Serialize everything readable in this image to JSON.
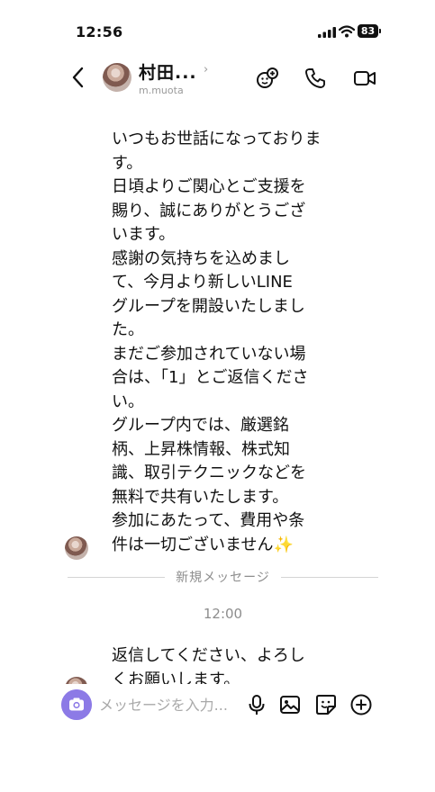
{
  "status_bar": {
    "time": "12:56",
    "battery": "83"
  },
  "header": {
    "contact_name": "村田...",
    "contact_id": "m.muota"
  },
  "messages": [
    {
      "lines": [
        "いつもお世話になっておりま",
        "す。",
        "日頃よりご関心とご支援を",
        "賜り、誠にありがとうござ",
        "います。",
        "感謝の気持ちを込めまし",
        "て、今月より新しいLINE",
        "グループを開設いたしまし",
        "た。",
        "まだご参加されていない場",
        "合は、「1」とご返信くださ",
        "い。",
        "グループ内では、厳選銘",
        "柄、上昇株情報、株式知",
        "識、取引テクニックなどを",
        "無料で共有いたします。",
        "参加にあたって、費用や条",
        "件は一切ございません✨"
      ]
    },
    {
      "lines": [
        "返信してください、よろし",
        "くお願いします。"
      ]
    }
  ],
  "divider": {
    "label": "新規メッセージ"
  },
  "timestamp": "12:00",
  "input": {
    "placeholder": "メッセージを入力..."
  },
  "colors": {
    "accent": "#8c7ae6",
    "muted": "#8d8d8d"
  }
}
